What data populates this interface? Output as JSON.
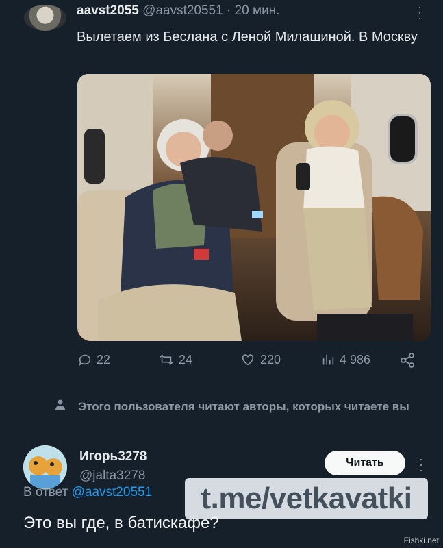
{
  "tweet": {
    "author_name": "aavst2055",
    "handle": "@aavst20551",
    "time": "· 20 мин.",
    "text": "Вылетаем из Беслана с Леной Милашиной. В Москву",
    "actions": {
      "replies": "22",
      "retweets": "24",
      "likes": "220",
      "views": "4 986"
    }
  },
  "notice": {
    "text": "Этого пользователя читают авторы, которых читаете вы"
  },
  "reply": {
    "author_name": "Игорь3278",
    "handle": "@jalta3278",
    "follow_label": "Читать",
    "reply_prefix": "В ответ",
    "reply_handle": "@aavst20551",
    "text": "Это вы где, в батискафе?"
  },
  "watermark": "t.me/vetkavatki",
  "credit": "Fishki.net",
  "colors": {
    "background": "#15202b",
    "link": "#1d9bf0",
    "muted": "#8b98a5"
  }
}
